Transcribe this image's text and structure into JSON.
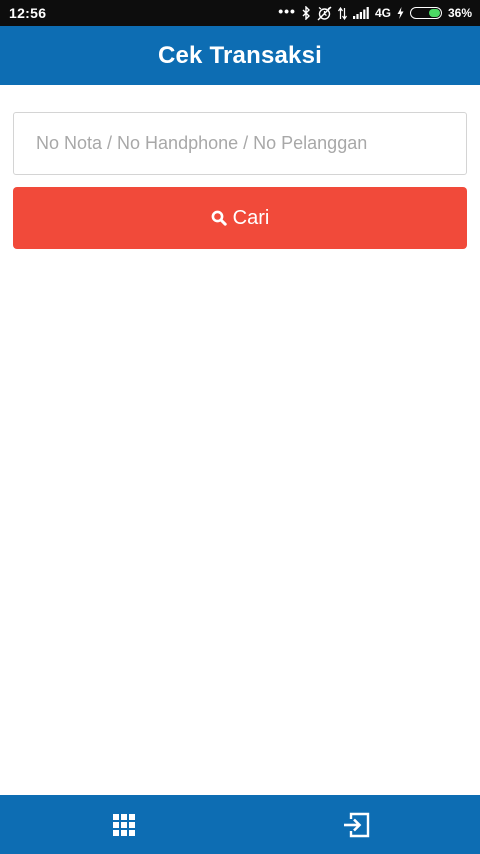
{
  "status_bar": {
    "time": "12:56",
    "network": "4G",
    "battery": "36%",
    "battery_level": 0.36,
    "icons": [
      "more-dots-icon",
      "bluetooth-icon",
      "alarm-off-icon",
      "data-arrows-icon",
      "signal-icon",
      "charging-icon",
      "battery-icon"
    ]
  },
  "app_bar": {
    "title": "Cek Transaksi"
  },
  "search": {
    "placeholder": "No Nota / No Handphone / No Pelanggan",
    "value": ""
  },
  "search_button": {
    "label": "Cari",
    "icon": "search-icon"
  },
  "bottom_bar": {
    "left_icon": "grid-menu-icon",
    "right_icon": "logout-icon"
  },
  "colors": {
    "app_bar": "#0d6db3",
    "button": "#f14a3a",
    "status_bar": "#0d0d0d",
    "battery_fill": "#4cd964"
  }
}
